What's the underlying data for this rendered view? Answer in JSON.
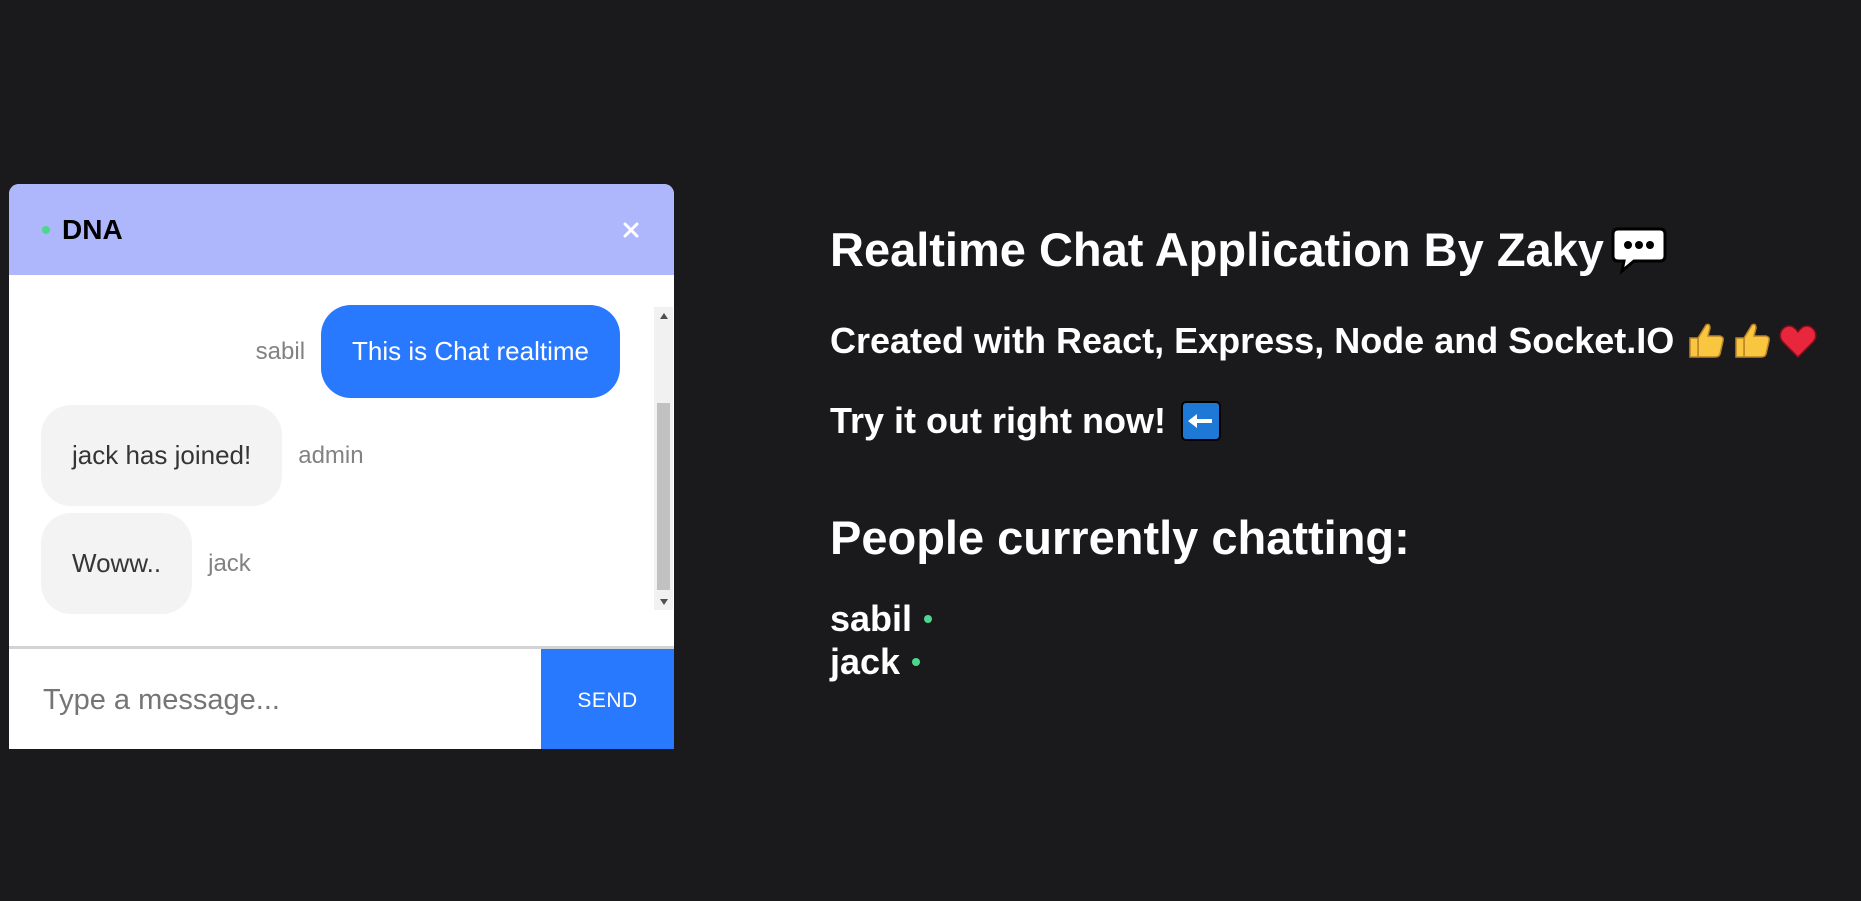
{
  "chat": {
    "room_name": "DNA",
    "messages": [
      {
        "sender": "sabil",
        "text": "This is Chat realtime",
        "own": true
      },
      {
        "sender": "admin",
        "text": "jack has joined!",
        "own": false
      },
      {
        "sender": "jack",
        "text": "Woww..",
        "own": false
      }
    ],
    "input_placeholder": "Type a message...",
    "send_label": "SEND"
  },
  "info": {
    "title": "Realtime Chat Application By Zaky",
    "subtitle": "Created with React, Express, Node and Socket.IO",
    "try_line": "Try it out right now!",
    "people_heading": "People currently chatting:",
    "people": [
      "sabil",
      "jack"
    ]
  },
  "icons": {
    "title_icon": "speech-bubble-icon",
    "subtitle_icons": [
      "thumbs-up-icon",
      "thumbs-up-icon",
      "heart-icon"
    ],
    "try_icon": "left-arrow-icon"
  },
  "colors": {
    "background": "#1a1a1d",
    "header": "#aeb6fc",
    "accent": "#2979ff",
    "online": "#4bd88c",
    "bubble_other": "#f3f3f3"
  }
}
